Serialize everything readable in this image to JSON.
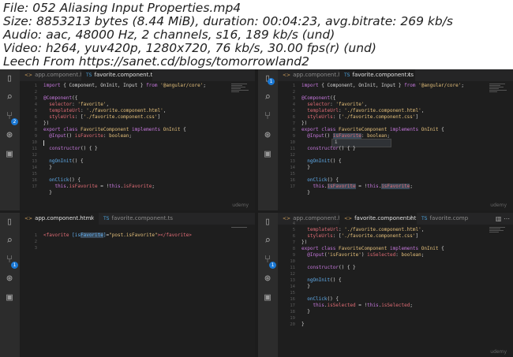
{
  "header": {
    "lines": [
      "File: 052 Aliasing Input Properties.mp4",
      "Size: 8853213 bytes (8.44 MiB), duration: 00:04:23, avg.bitrate: 269 kb/s",
      "Audio: aac, 48000 Hz, 2 channels, s16, 189 kb/s (und)",
      "Video: h264, yuv420p, 1280x720, 76 kb/s, 30.00 fps(r) (und)",
      "Leech From https://sanet.cd/blogs/tomorrowland2"
    ]
  },
  "panes": {
    "tl": {
      "tabs": [
        {
          "label": "app.component.html",
          "icon": "<>"
        },
        {
          "label": "favorite.component.ts",
          "icon": "TS"
        }
      ],
      "badge": "2",
      "lines": [
        "1",
        "2",
        "3",
        "4",
        "5",
        "6",
        "7",
        "8",
        "9",
        "10",
        "11",
        "12",
        "13",
        "14",
        "15",
        "16",
        "17"
      ]
    },
    "tr": {
      "tabs": [
        {
          "label": "app.component.html",
          "icon": "<>"
        },
        {
          "label": "favorite.component.ts",
          "icon": "TS"
        }
      ],
      "badge": "1",
      "lines": [
        "1",
        "2",
        "3",
        "4",
        "5",
        "6",
        "7",
        "8",
        "9",
        "10",
        "11",
        "12",
        "13",
        "14",
        "15",
        "16",
        "17"
      ],
      "tooltip": "i"
    },
    "bl": {
      "tabs": [
        {
          "label": "app.component.html",
          "icon": "<>"
        },
        {
          "label": "favorite.component.ts",
          "icon": "TS"
        }
      ],
      "badge": "1",
      "lines": [
        "1",
        "2",
        "3"
      ]
    },
    "br": {
      "tabs": [
        {
          "label": "app.component.html",
          "icon": "<>"
        },
        {
          "label": "favorite.component.html",
          "icon": "<>"
        },
        {
          "label": "favorite.comp",
          "icon": "TS"
        }
      ],
      "badge": "1",
      "lines": [
        "4",
        "5",
        "6",
        "7",
        "8",
        "9",
        "10",
        "11",
        "12",
        "13",
        "14",
        "15",
        "16",
        "17",
        "18",
        "19",
        "20"
      ]
    }
  },
  "watermark": "udemy"
}
